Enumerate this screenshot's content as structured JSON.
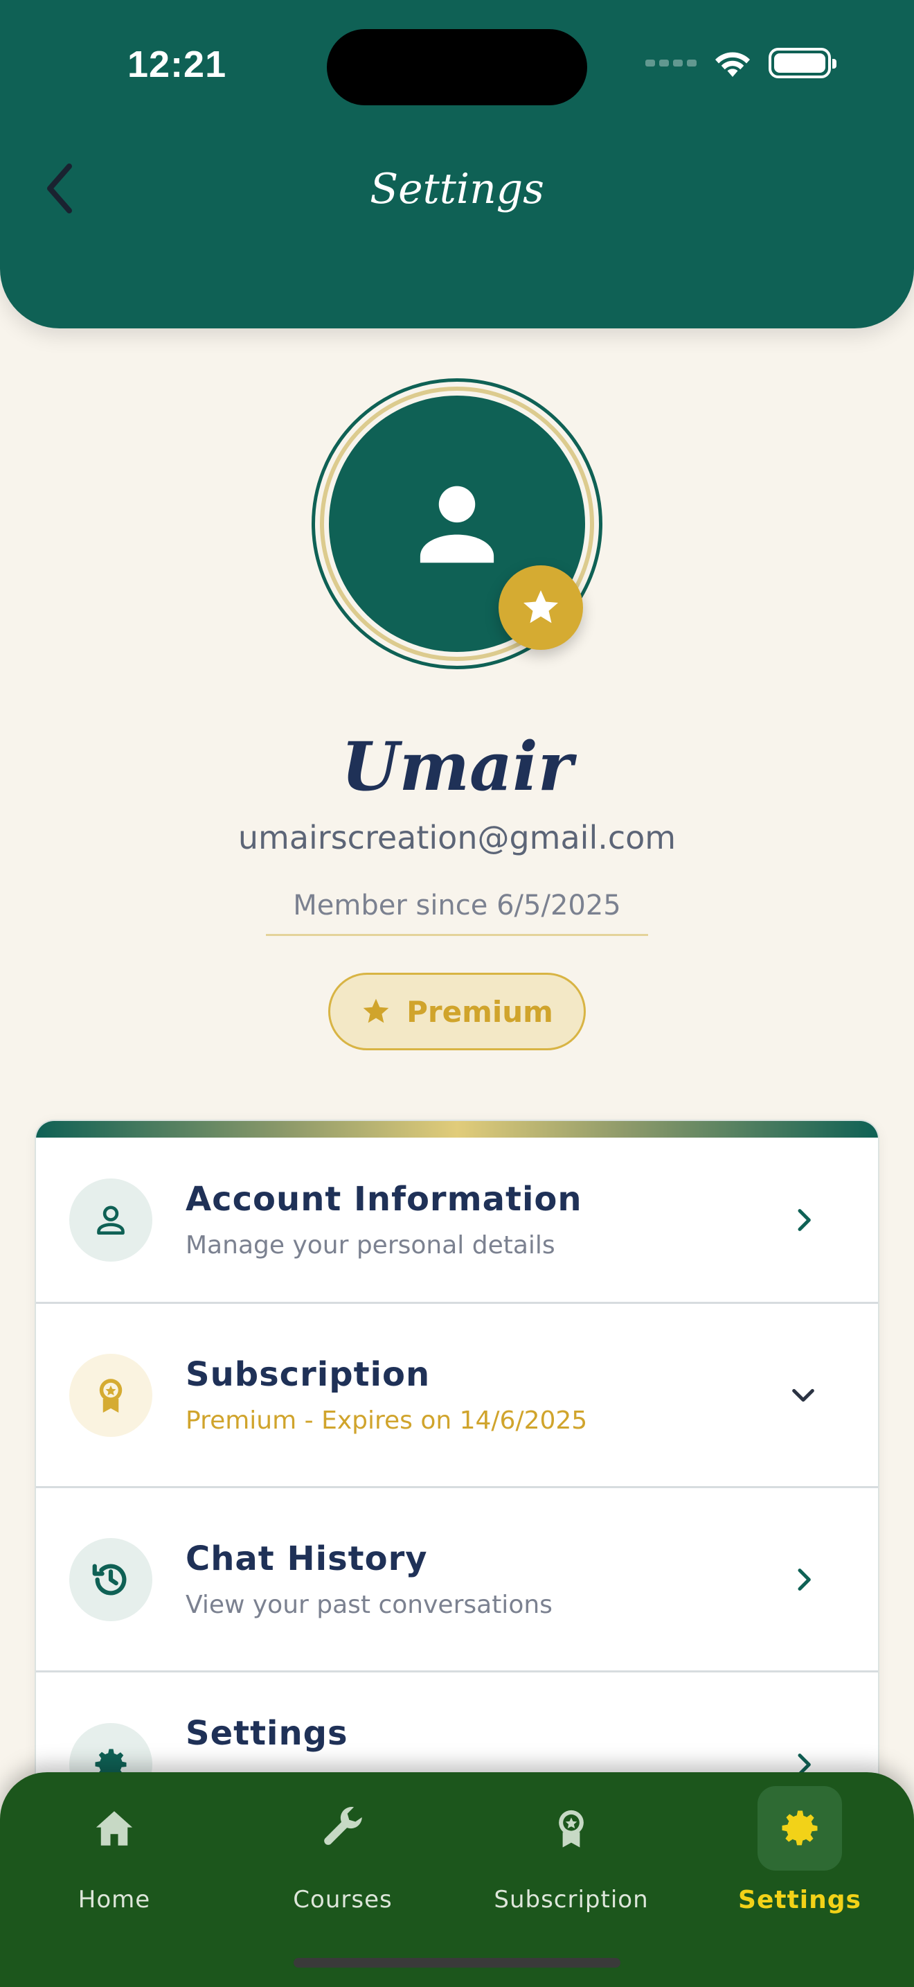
{
  "status_bar": {
    "time": "12:21"
  },
  "header": {
    "title": "Settings"
  },
  "profile": {
    "name": "Umair",
    "email": "umairscreation@gmail.com",
    "member_since": "Member since 6/5/2025",
    "badge_label": "Premium"
  },
  "menu": {
    "items": [
      {
        "title": "Account Information",
        "subtitle": "Manage your personal details",
        "icon": "person-icon",
        "chevron": "chevron-right-icon"
      },
      {
        "title": "Subscription",
        "subtitle": "Premium - Expires on 14/6/2025",
        "icon": "award-icon",
        "chevron": "chevron-down-icon"
      },
      {
        "title": "Chat History",
        "subtitle": "View your past conversations",
        "icon": "history-icon",
        "chevron": "chevron-right-icon"
      },
      {
        "title": "Settings",
        "subtitle": "",
        "icon": "gear-icon",
        "chevron": "chevron-right-icon"
      }
    ]
  },
  "bottom_nav": {
    "items": [
      {
        "label": "Home",
        "icon": "home-icon",
        "active": false
      },
      {
        "label": "Courses",
        "icon": "wrench-icon",
        "active": false
      },
      {
        "label": "Subscription",
        "icon": "award-icon",
        "active": false
      },
      {
        "label": "Settings",
        "icon": "gear-icon",
        "active": true
      }
    ]
  },
  "colors": {
    "primary": "#0F6155",
    "gold": "#D5AB32",
    "navy": "#1F3157",
    "nav_bg": "#1C561C",
    "nav_active": "#F2D218",
    "background": "#F8F4EC"
  }
}
